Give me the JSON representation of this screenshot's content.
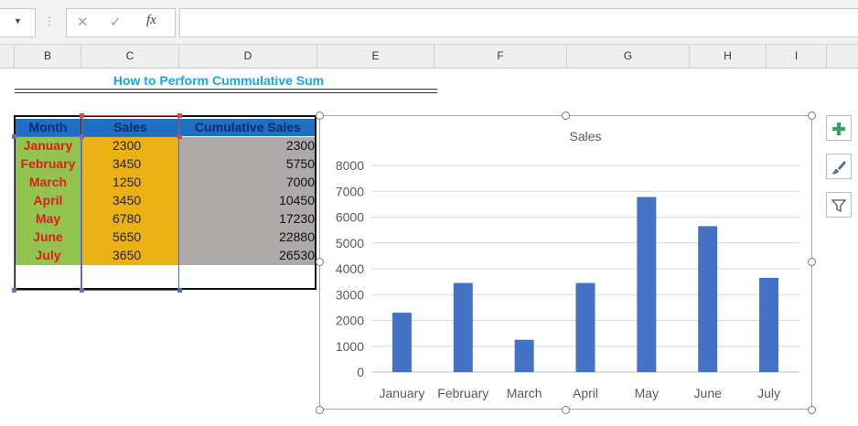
{
  "formula_bar": {
    "name_box_value": "",
    "fx_label": "fx",
    "formula_value": ""
  },
  "columns": [
    "B",
    "C",
    "D",
    "E",
    "F",
    "G",
    "H",
    "I"
  ],
  "title": "How to Perform Cummulative Sum",
  "table": {
    "headers": [
      "Month",
      "Sales",
      "Cumulative Sales"
    ],
    "rows": [
      [
        "January",
        "2300",
        "2300"
      ],
      [
        "February",
        "3450",
        "5750"
      ],
      [
        "March",
        "1250",
        "7000"
      ],
      [
        "April",
        "3450",
        "10450"
      ],
      [
        "May",
        "6780",
        "17230"
      ],
      [
        "June",
        "5650",
        "22880"
      ],
      [
        "July",
        "3650",
        "26530"
      ]
    ]
  },
  "colors": {
    "header_fill": "#1f6fc5",
    "month_fill": "#92c44f",
    "month_text": "#e11c1c",
    "sales_fill": "#eab214",
    "cumulative_fill": "#aeaaa9",
    "title_color": "#1ba6e6",
    "bar_color": "#4472c4"
  },
  "chart_data": {
    "type": "bar",
    "title": "Sales",
    "categories": [
      "January",
      "February",
      "March",
      "April",
      "May",
      "June",
      "July"
    ],
    "values": [
      2300,
      3450,
      1250,
      3450,
      6780,
      5650,
      3650
    ],
    "ylim": [
      0,
      8000
    ],
    "yticks": [
      "0",
      "1000",
      "2000",
      "3000",
      "4000",
      "5000",
      "6000",
      "7000",
      "8000"
    ],
    "xlabel": "",
    "ylabel": "",
    "grid": true,
    "legend": "none"
  },
  "chart_tools": {
    "elements_icon": "plus-icon",
    "styles_icon": "brush-icon",
    "filter_icon": "filter-icon"
  }
}
